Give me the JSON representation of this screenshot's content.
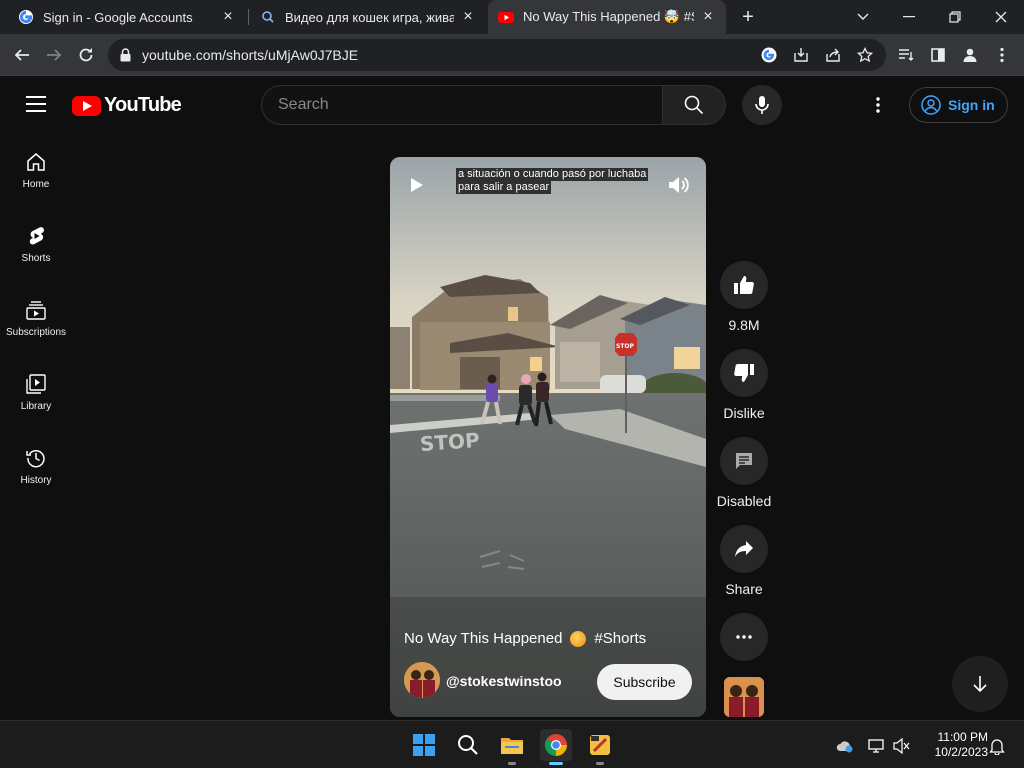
{
  "browser": {
    "tabs": [
      {
        "title": "Sign in - Google Accounts",
        "active": false
      },
      {
        "title": "Видео для кошек игра, живая м",
        "active": false
      },
      {
        "title": "No Way This Happened 🤯 #Shorts",
        "active": true
      }
    ],
    "url": "youtube.com/shorts/uMjAw0J7BJE"
  },
  "header": {
    "logo_text": "YouTube",
    "search_placeholder": "Search",
    "sign_in_label": "Sign in"
  },
  "sidebar": {
    "items": [
      {
        "label": "Home",
        "icon": "home-icon"
      },
      {
        "label": "Shorts",
        "icon": "shorts-icon"
      },
      {
        "label": "Subscriptions",
        "icon": "subscriptions-icon"
      },
      {
        "label": "Library",
        "icon": "library-icon"
      },
      {
        "label": "History",
        "icon": "history-icon"
      }
    ]
  },
  "video": {
    "caption_line1": "a situación o cuando pasó por luchaba",
    "caption_line2": "para salir a pasear",
    "title_text": "No Way This Happened",
    "title_tag": "#Shorts",
    "channel": "@stokestwinstoo",
    "subscribe_label": "Subscribe"
  },
  "actions": {
    "likes": "9.8M",
    "dislike_label": "Dislike",
    "comments_label": "Disabled",
    "share_label": "Share"
  },
  "taskbar": {
    "time": "11:00 PM",
    "date": "10/2/2023"
  },
  "colors": {
    "background": "#0f0f0f",
    "accent_red": "#ff0000",
    "link_blue": "#3ea6ff"
  }
}
